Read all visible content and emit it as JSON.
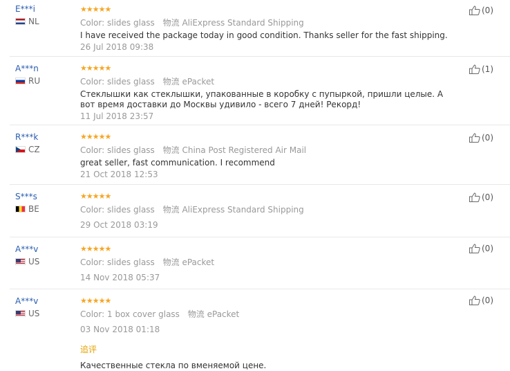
{
  "reviews": [
    {
      "user": "E***i",
      "country": "NL",
      "flag": "nl",
      "stars": "★★★★★",
      "color_label": "Color:",
      "color_value": "slides glass",
      "logistics_label": "物流",
      "logistics_value": "AliExpress Standard Shipping",
      "text": "I have received the package today in good condition. Thanks seller for the fast shipping.",
      "date": "26 Jul 2018 09:38",
      "helpful": "(0)"
    },
    {
      "user": "A***n",
      "country": "RU",
      "flag": "ru",
      "stars": "★★★★★",
      "color_label": "Color:",
      "color_value": "slides glass",
      "logistics_label": "物流",
      "logistics_value": "ePacket",
      "text": "Стеклышки как стеклышки, упакованные в коробку с пупыркой, пришли целые. А вот время доставки до Москвы удивило - всего 7 дней! Рекорд!",
      "date": "11 Jul 2018 23:57",
      "helpful": "(1)"
    },
    {
      "user": "R***k",
      "country": "CZ",
      "flag": "cz",
      "stars": "★★★★★",
      "color_label": "Color:",
      "color_value": "slides glass",
      "logistics_label": "物流",
      "logistics_value": "China Post Registered Air Mail",
      "text": "great seller, fast communication. I recommend",
      "date": "21 Oct 2018 12:53",
      "helpful": "(0)"
    },
    {
      "user": "S***s",
      "country": "BE",
      "flag": "be",
      "stars": "★★★★★",
      "color_label": "Color:",
      "color_value": "slides glass",
      "logistics_label": "物流",
      "logistics_value": "AliExpress Standard Shipping",
      "text": "",
      "date": "29 Oct 2018 03:19",
      "helpful": "(0)"
    },
    {
      "user": "A***v",
      "country": "US",
      "flag": "us",
      "stars": "★★★★★",
      "color_label": "Color:",
      "color_value": "slides glass",
      "logistics_label": "物流",
      "logistics_value": "ePacket",
      "text": "",
      "date": "14 Nov 2018 05:37",
      "helpful": "(0)"
    },
    {
      "user": "A***v",
      "country": "US",
      "flag": "us",
      "stars": "★★★★★",
      "color_label": "Color:",
      "color_value": "1 box cover glass",
      "logistics_label": "物流",
      "logistics_value": "ePacket",
      "text": "",
      "date": "03 Nov 2018 01:18",
      "helpful": "(0)",
      "append_label": "追评",
      "append_text": "Качественные стекла по вменяемой цене."
    }
  ],
  "colors": {
    "star": "#f5a623",
    "username": "#2a5db0",
    "append": "#e5a100"
  }
}
